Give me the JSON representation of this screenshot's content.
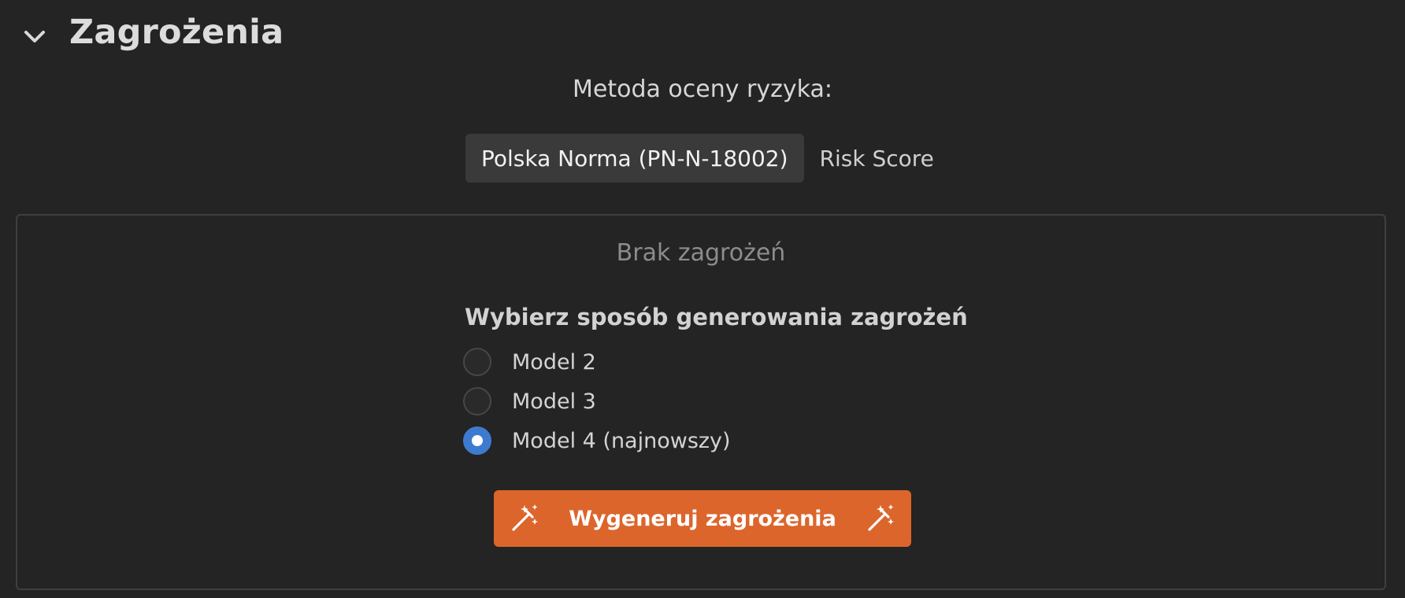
{
  "section": {
    "title": "Zagrożenia",
    "toggle_icon": "chevron-down-icon"
  },
  "risk_method": {
    "label": "Metoda oceny ryzyka:",
    "options": [
      {
        "label": "Polska Norma (PN-N-18002)",
        "selected": true
      },
      {
        "label": "Risk Score",
        "selected": false
      }
    ]
  },
  "threats_panel": {
    "empty_text": "Brak zagrożeń",
    "generation_title": "Wybierz sposób generowania zagrożeń",
    "models": [
      {
        "label": "Model 2",
        "checked": false
      },
      {
        "label": "Model 3",
        "checked": false
      },
      {
        "label": "Model 4 (najnowszy)",
        "checked": true
      }
    ],
    "generate_button": {
      "label": "Wygeneruj zagrożenia",
      "icon": "magic-wand-icon"
    }
  },
  "colors": {
    "background": "#242424",
    "accent_button": "#dc652c",
    "radio_checked": "#3d7bd0",
    "active_segment": "#3a3a3a"
  }
}
